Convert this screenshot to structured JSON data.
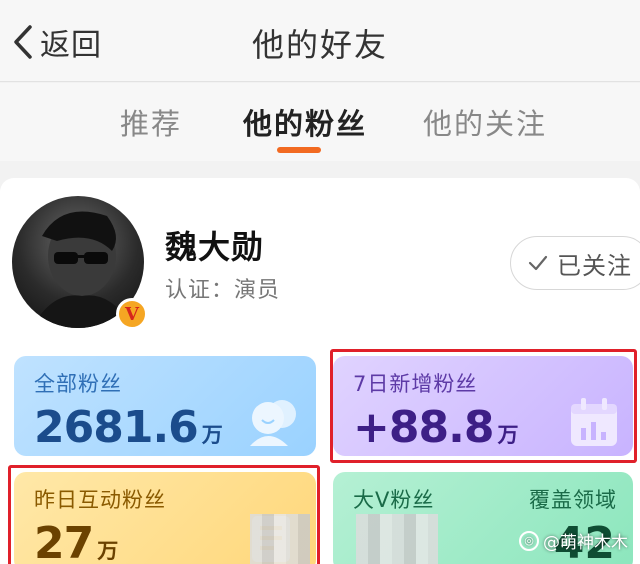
{
  "header": {
    "back_label": "返回",
    "title": "他的好友"
  },
  "tabs": [
    {
      "label": "推荐",
      "active": false
    },
    {
      "label": "他的粉丝",
      "active": true
    },
    {
      "label": "他的关注",
      "active": false
    }
  ],
  "colors": {
    "accent": "#f26a21",
    "highlight_box": "#e0202a",
    "verified_badge": "#f5a623"
  },
  "profile": {
    "name": "魏大勋",
    "verify_text": "认证：演员",
    "badge_letter": "V",
    "follow_label": "已关注",
    "follow_icon": "check-icon"
  },
  "stats": [
    {
      "label": "全部粉丝",
      "value": "2681.6",
      "unit": "万",
      "icon": "fans-icon",
      "highlighted": false
    },
    {
      "label": "7日新增粉丝",
      "value": "+88.8",
      "unit": "万",
      "icon": "calendar-chart-icon",
      "highlighted": true
    },
    {
      "label": "昨日互动粉丝",
      "value": "27",
      "unit": "万",
      "icon": "document-icon",
      "highlighted": true
    },
    {
      "label": "大V粉丝",
      "label2": "覆盖领域",
      "value2": "42",
      "icon": "bigv-icon",
      "highlighted": false
    }
  ],
  "watermark": "@萌神木木"
}
